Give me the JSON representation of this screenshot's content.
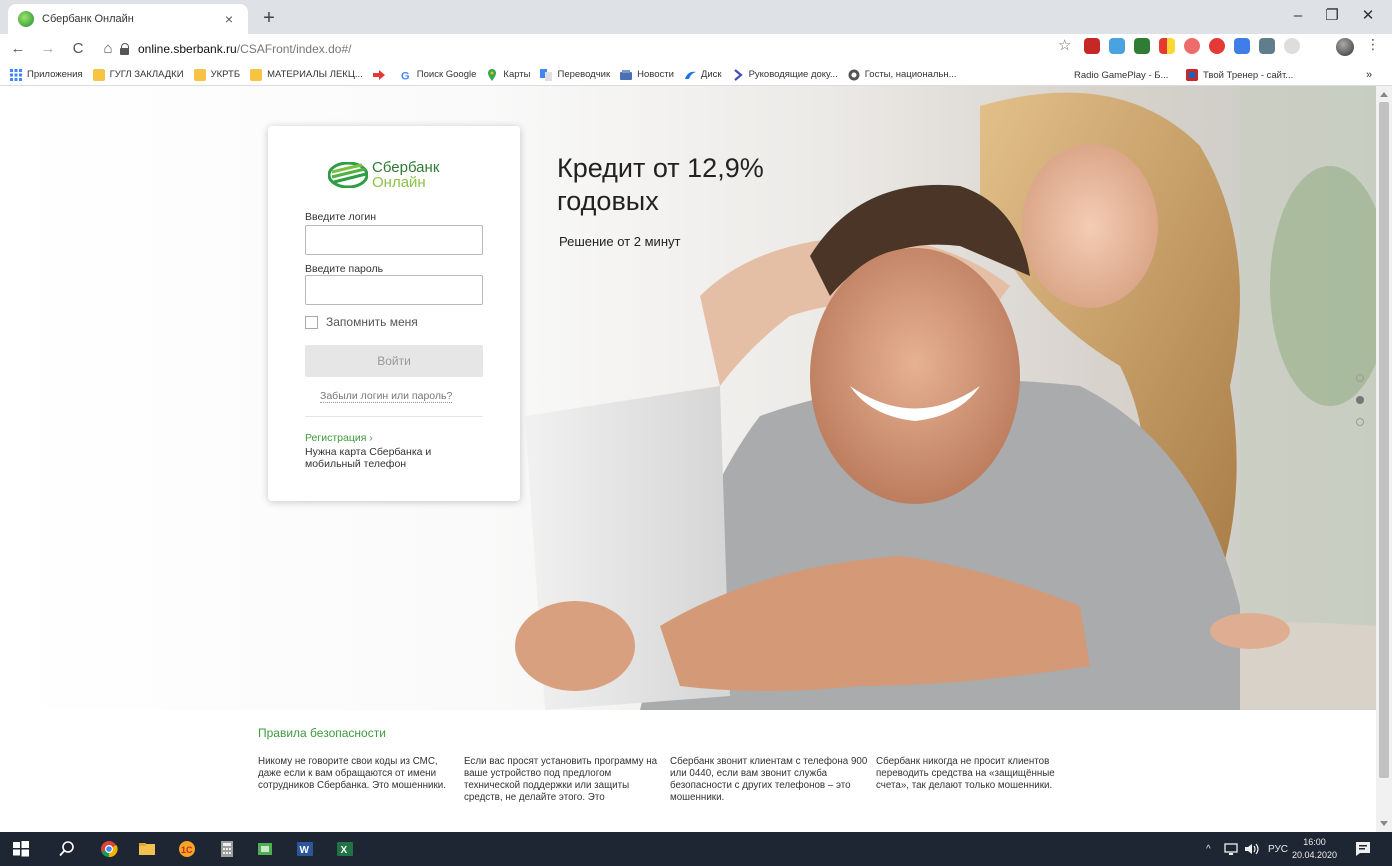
{
  "browser": {
    "tab_title": "Сбербанк Онлайн",
    "tab_close": "×",
    "new_tab": "+",
    "window_controls": {
      "minimize": "–",
      "restore": "❐",
      "close": "✕"
    },
    "nav": {
      "back": "←",
      "forward": "→",
      "reload": "C",
      "home": "⌂"
    },
    "url_host": "online.sberbank.ru",
    "url_path": "/CSAFront/index.do#/",
    "bookmark_star": "☆",
    "menu": "⋮",
    "bookmarks": [
      {
        "label": "Приложения",
        "icon": "apps-grid-icon"
      },
      {
        "label": "ГУГЛ ЗАКЛАДКИ",
        "icon": "folder-icon"
      },
      {
        "label": "УКРТБ",
        "icon": "folder-icon"
      },
      {
        "label": "МАТЕРИАЛЫ ЛЕКЦ...",
        "icon": "folder-icon"
      },
      {
        "label": "",
        "icon": "red-arrow-icon"
      },
      {
        "label": "Поиск Google",
        "icon": "google-icon"
      },
      {
        "label": "Карты",
        "icon": "maps-pin-icon"
      },
      {
        "label": "Переводчик",
        "icon": "translate-icon"
      },
      {
        "label": "Новости",
        "icon": "news-icon"
      },
      {
        "label": "Диск",
        "icon": "drive-icon"
      },
      {
        "label": "Руководящие доку...",
        "icon": "chevron-right-icon"
      },
      {
        "label": "Госты, национальн...",
        "icon": "globe-icon"
      }
    ],
    "bookmarks_right": [
      {
        "label": "Radio GamePlay - Б..."
      },
      {
        "label": "Твой Тренер - сайт..."
      }
    ],
    "bookmarks_more": "»"
  },
  "login": {
    "logo_line1": "Сбербанк",
    "logo_line2": "Онлайн",
    "login_label": "Введите логин",
    "login_value": "",
    "password_label": "Введите пароль",
    "password_value": "",
    "remember_label": "Запомнить меня",
    "remember_checked": false,
    "submit_label": "Войти",
    "forgot_link": "Забыли логин или пароль?",
    "register_link": "Регистрация  ›",
    "register_hint": "Нужна карта Сбербанка и мобильный телефон"
  },
  "promo": {
    "title_line1": "Кредит от 12,9%",
    "title_line2": "годовых",
    "subtitle": "Решение от 2 минут",
    "slides_total": 3,
    "slide_active": 2
  },
  "safety": {
    "title": "Правила безопасности",
    "tips": [
      "Никому не говорите свои коды из СМС, даже если к вам обращаются от имени сотрудников Сбербанка. Это мошенники.",
      "Если вас просят установить программу на ваше устройство под предлогом технической поддержки или защиты средств, не делайте этого. Это",
      "Сбербанк звонит клиентам с телефона 900 или 0440, если вам звонит служба безопасности с других телефонов – это мошенники.",
      "Сбербанк никогда не просит клиентов переводить средства на «защищённые счета», так делают только мошенники."
    ]
  },
  "taskbar": {
    "tray_chevron": "^",
    "language": "РУС",
    "time": "16:00",
    "date": "20.04.2020"
  },
  "colors": {
    "brand_green": "#3d9b3d",
    "brand_dark_green": "#2e7d32",
    "brand_light_green": "#8bc34a",
    "taskbar": "#1e2633"
  }
}
